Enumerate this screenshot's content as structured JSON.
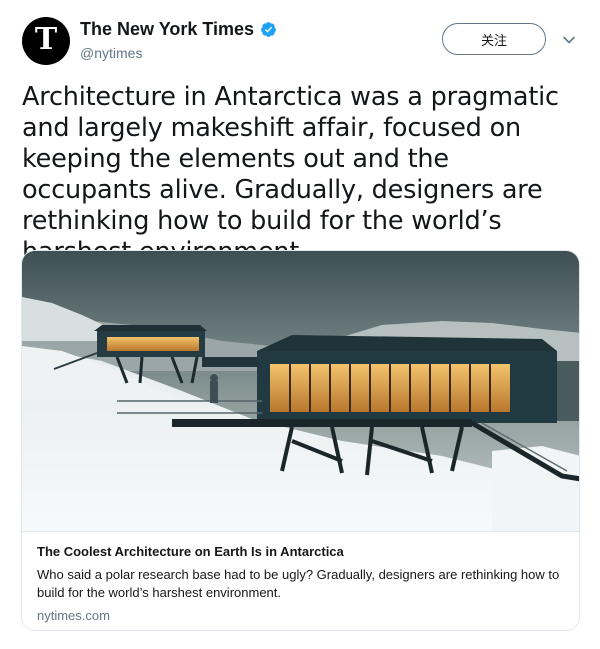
{
  "author": {
    "name": "The New York Times",
    "handle": "@nytimes",
    "avatar_letter": "T",
    "verified_icon": "verified-badge-icon",
    "verified_color": "#1da1f2"
  },
  "actions": {
    "follow_label": "关注",
    "more_icon": "chevron-down-icon"
  },
  "tweet": {
    "text": "Architecture in Antarctica was a pragmatic and largely makeshift affair, focused on keeping the elements out and the occupants alive. Gradually, designers are rethinking how to build for the world’s harshest environment."
  },
  "card": {
    "title": "The Coolest Architecture on Earth Is in Antarctica",
    "description": "Who said a polar research base had to be ugly? Gradually, designers are rethinking how to build for the world’s harshest environment.",
    "domain": "nytimes.com"
  },
  "colors": {
    "text_primary": "#14171a",
    "text_secondary": "#657786",
    "border": "#e1e8ed"
  }
}
